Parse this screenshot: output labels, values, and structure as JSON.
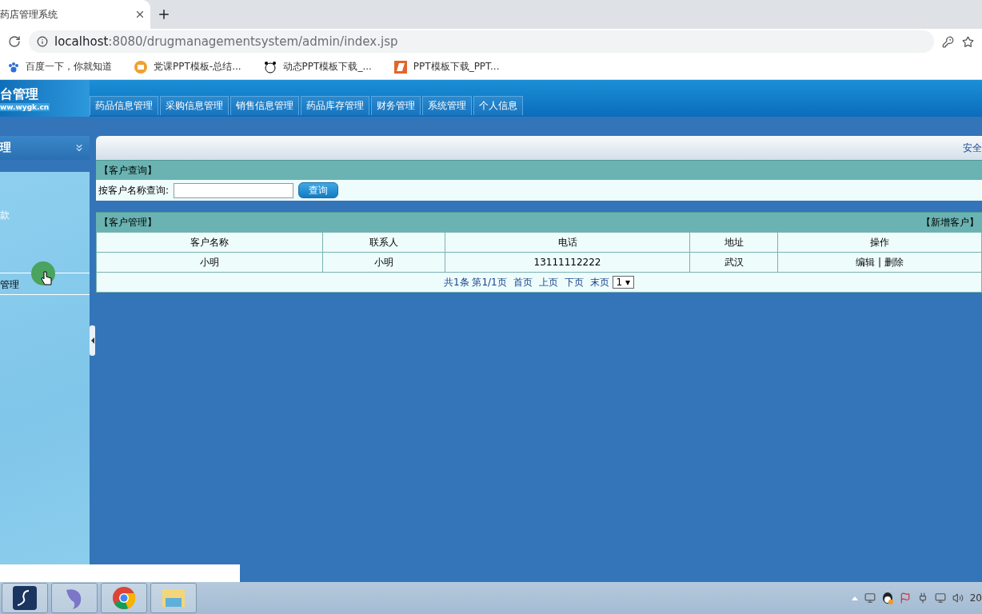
{
  "browser": {
    "tab_title": "药店管理系统",
    "url_host": "localhost",
    "url_path": ":8080/drugmanagementsystem/admin/index.jsp",
    "bookmarks": [
      {
        "kind": "paw",
        "label": "百度一下，你就知道"
      },
      {
        "kind": "folder",
        "label": "党课PPT模板-总结..."
      },
      {
        "kind": "panda",
        "label": "动态PPT模板下载_..."
      },
      {
        "kind": "page",
        "label": "PPT模板下载_PPT..."
      }
    ]
  },
  "header": {
    "logo_title": "台管理",
    "logo_url": "ww.wygk.cn",
    "nav": [
      {
        "label": "药品信息管理",
        "selected": false
      },
      {
        "label": "采购信息管理",
        "selected": false
      },
      {
        "label": "销售信息管理",
        "selected": false
      },
      {
        "label": "药品库存管理",
        "selected": false
      },
      {
        "label": "财务管理",
        "selected": false
      },
      {
        "label": "系统管理",
        "selected": false
      },
      {
        "label": "个人信息",
        "selected": false
      }
    ]
  },
  "sidebar": {
    "title": "理",
    "items": [
      {
        "label": "款",
        "selected": false
      },
      {
        "label": "管理",
        "selected": true
      }
    ]
  },
  "topbar": {
    "text": "安全"
  },
  "search": {
    "title": "【客户查询】",
    "label": "按客户名称查询:",
    "button": "查询"
  },
  "table": {
    "title": "【客户管理】",
    "add_link": "【新增客户】",
    "columns": [
      "客户名称",
      "联系人",
      "电话",
      "地址",
      "操作"
    ],
    "rows": [
      {
        "cells": [
          "小明",
          "小明",
          "13111112222",
          "武汉"
        ],
        "actions": [
          "编辑",
          "删除"
        ],
        "separator": "|"
      }
    ]
  },
  "pagination": {
    "summary": "共1条",
    "page": "第1/1页",
    "links": [
      "首页",
      "上页",
      "下页",
      "末页"
    ],
    "select": "1",
    "select_caret": "▾"
  },
  "taskbar": {
    "apps": [
      {
        "kind": "script"
      },
      {
        "kind": "dolphin"
      },
      {
        "kind": "chrome"
      },
      {
        "kind": "explorer"
      }
    ],
    "clock": "20"
  }
}
